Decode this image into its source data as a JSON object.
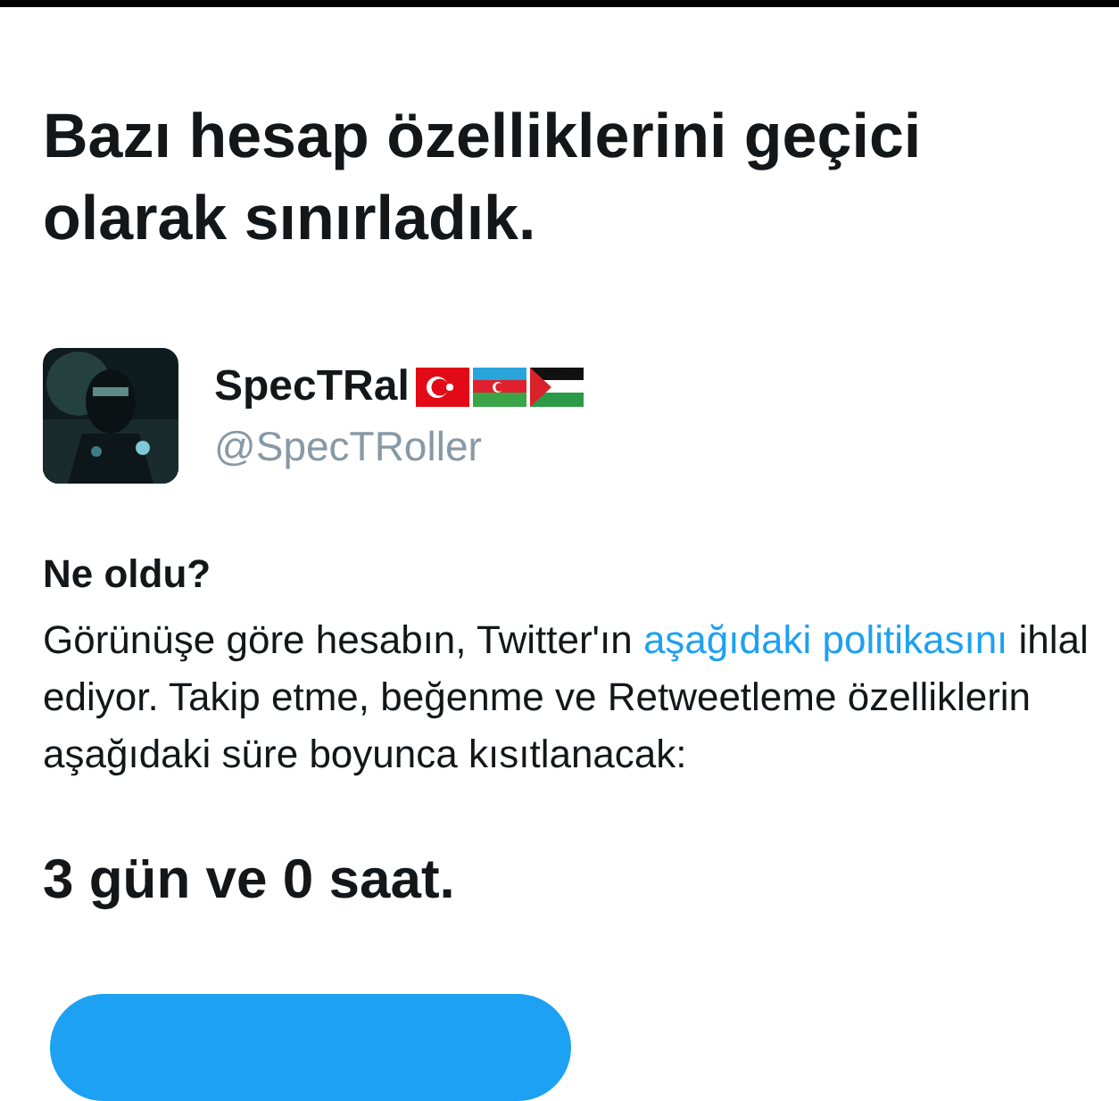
{
  "title": "Bazı hesap özelliklerini geçici olarak sınırladık.",
  "account": {
    "name": "SpecTRal",
    "handle": "@SpecTRoller",
    "flags": [
      {
        "kind": "turkey"
      },
      {
        "kind": "azerbaijan"
      },
      {
        "kind": "palestine"
      }
    ]
  },
  "section_heading": "Ne oldu?",
  "body": {
    "before": "Görünüşe göre hesabın, Twitter'ın",
    "link": "aşağıdaki politikasını",
    "after": "ihlal ediyor. Takip etme, beğenme ve Retweetleme özelliklerin aşağıdaki süre boyunca kısıtlanacak:"
  },
  "duration": "3 gün ve 0 saat."
}
